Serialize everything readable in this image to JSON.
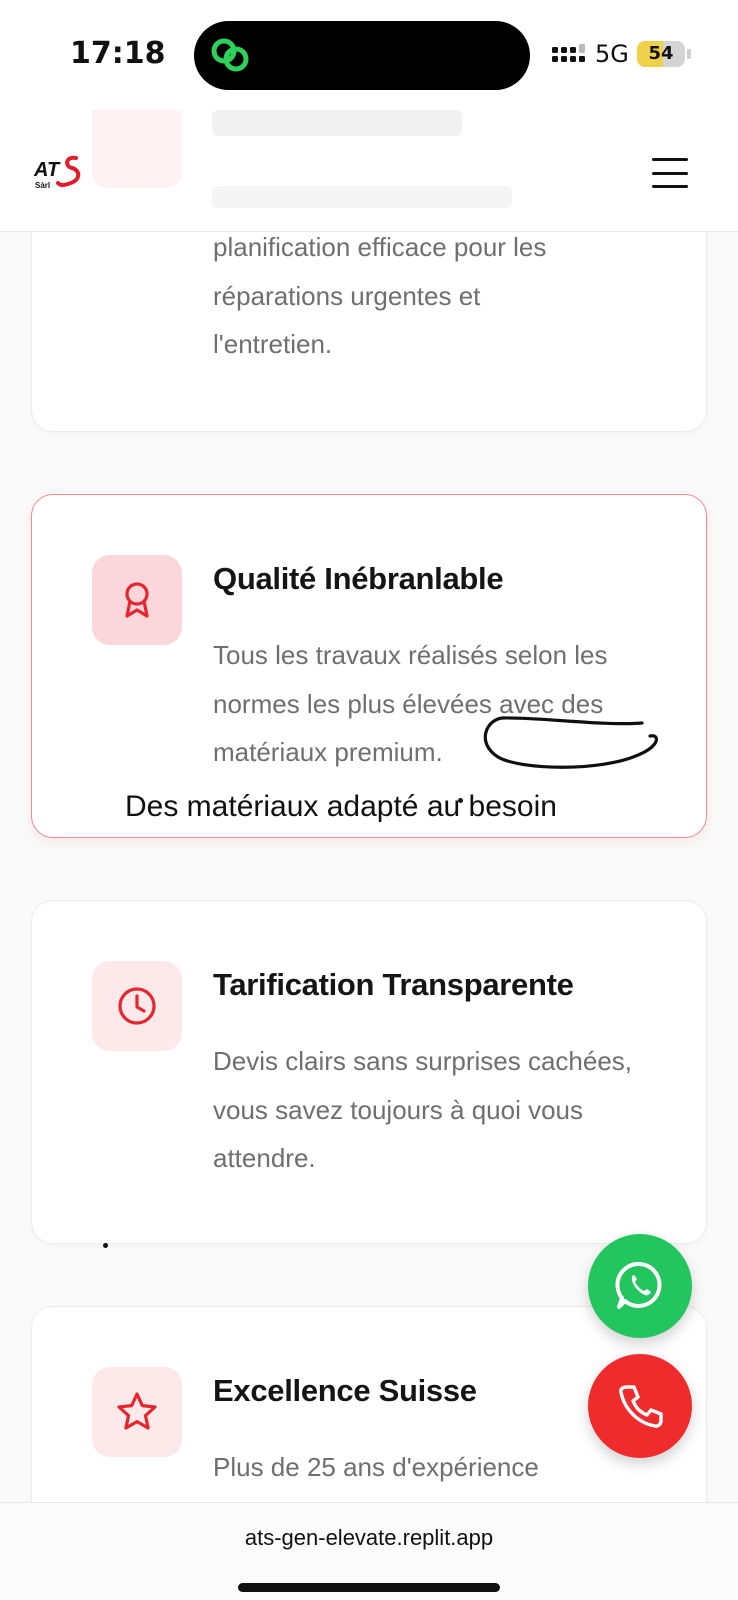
{
  "status_bar": {
    "time": "17:18",
    "network": "5G",
    "battery_label": "54",
    "battery_level": 0.54
  },
  "header": {
    "logo_alt": "ATS Sàrl"
  },
  "cards": [
    {
      "id": "cut-card",
      "desc_lines": [
        "planification efficace pour les",
        "réparations urgentes et",
        "l'entretien."
      ]
    },
    {
      "id": "quality",
      "icon": "award-ribbon-icon",
      "title": "Qualité Inébranlable",
      "desc": "Tous les travaux réalisés selon les normes les plus élevées avec des matériaux premium."
    },
    {
      "id": "pricing",
      "icon": "clock-icon",
      "title": "Tarification Transparente",
      "desc": "Devis clairs sans surprises cachées, vous savez toujours à quoi vous attendre."
    },
    {
      "id": "excellence",
      "icon": "star-icon",
      "title": "Excellence Suisse",
      "desc": "Plus de 25 ans d'expérience"
    }
  ],
  "annotation": {
    "text": "Des matériaux adapté au besoin"
  },
  "fab": {
    "whatsapp_icon": "whatsapp-icon",
    "phone_icon": "phone-icon"
  },
  "browser": {
    "url": "ats-gen-elevate.replit.app"
  },
  "colors": {
    "accent_red": "#ef2b2b",
    "icon_bg": "#fde8ea",
    "whatsapp_green": "#22c55e"
  }
}
